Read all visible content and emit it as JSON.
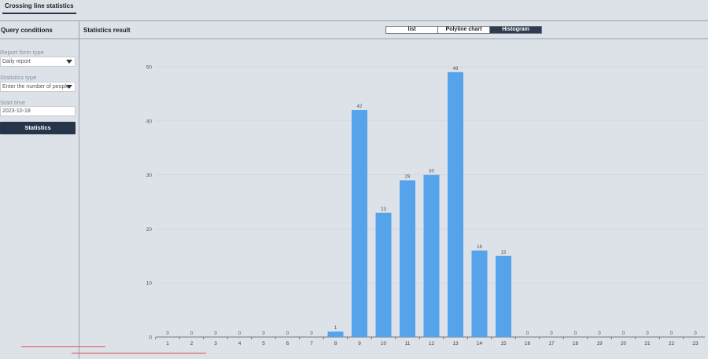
{
  "tabs": [
    {
      "label": "Crossing line statistics"
    }
  ],
  "query": {
    "title": "Query conditions",
    "report_form_type": {
      "label": "Report form type",
      "value": "Daily report"
    },
    "statistics_type": {
      "label": "Statistics type",
      "value": "Enter the number of people"
    },
    "start_time": {
      "label": "Start time",
      "value": "2023-10-18"
    },
    "statistics_button": "Statistics"
  },
  "result": {
    "title": "Statistics result",
    "view_switch": [
      {
        "label": "list",
        "active": false
      },
      {
        "label": "Polyline chart",
        "active": false
      },
      {
        "label": "Histogram",
        "active": true
      }
    ]
  },
  "colors": {
    "bar": "#55a3ea",
    "accent": "#27354a",
    "underline": "#e05050"
  },
  "chart_data": {
    "type": "bar",
    "categories": [
      "1",
      "2",
      "3",
      "4",
      "5",
      "6",
      "7",
      "8",
      "9",
      "10",
      "11",
      "12",
      "13",
      "14",
      "15",
      "16",
      "17",
      "18",
      "19",
      "20",
      "21",
      "22",
      "23"
    ],
    "values": [
      0,
      0,
      0,
      0,
      0,
      0,
      0,
      1,
      42,
      23,
      29,
      30,
      49,
      16,
      15,
      0,
      0,
      0,
      0,
      0,
      0,
      0,
      0
    ],
    "yticks": [
      0,
      10,
      20,
      30,
      40,
      50
    ],
    "ylim": [
      0,
      50
    ],
    "grid": true
  }
}
